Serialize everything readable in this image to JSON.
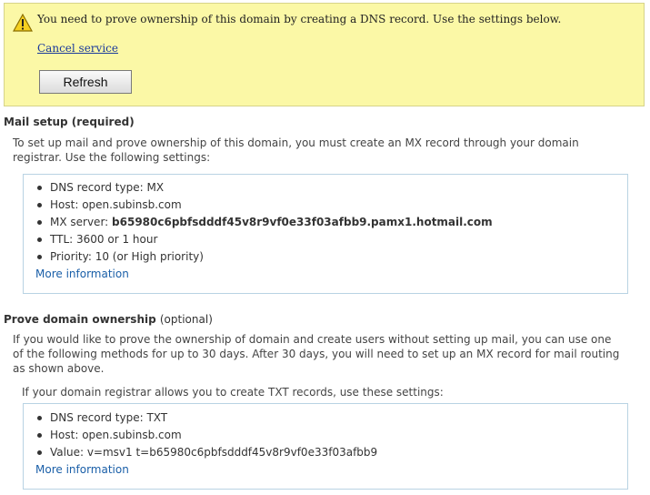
{
  "notice": {
    "message": "You need to prove ownership of this domain by creating a DNS record. Use the settings below.",
    "cancel_link": "Cancel service",
    "refresh_button": "Refresh",
    "icon": "warning-icon",
    "bg_color": "#fbf8a6"
  },
  "mail_setup": {
    "heading": "Mail setup (required)",
    "intro": "To set up mail and prove ownership of this domain, you must create an MX record through your domain registrar. Use the following settings:",
    "items": [
      {
        "label": "DNS record type: ",
        "value": "MX"
      },
      {
        "label": "Host: ",
        "value": "open.subinsb.com"
      },
      {
        "label": "MX server: ",
        "value": "b65980c6pbfsdddf45v8r9vf0e33f03afbb9.pamx1.hotmail.com"
      },
      {
        "label": "TTL: ",
        "value": "3600 or 1 hour"
      },
      {
        "label": "Priority: ",
        "value": "10 (or High priority)"
      }
    ],
    "more_info": "More information"
  },
  "prove_ownership": {
    "heading": "Prove domain ownership",
    "heading_note": "(optional)",
    "intro": "If you would like to prove the ownership of domain and create users without setting up mail, you can use one of the following methods for up to 30 days. After 30 days, you will need to set up an MX record for mail routing as shown above.",
    "txt_intro": "If your domain registrar allows you to create TXT records, use these settings:",
    "items": [
      {
        "label": "DNS record type: ",
        "value": "TXT"
      },
      {
        "label": "Host: ",
        "value": "open.subinsb.com"
      },
      {
        "label": "Value: ",
        "value": "v=msv1 t=b65980c6pbfsdddf45v8r9vf0e33f03afbb9"
      }
    ],
    "more_info": "More information"
  }
}
